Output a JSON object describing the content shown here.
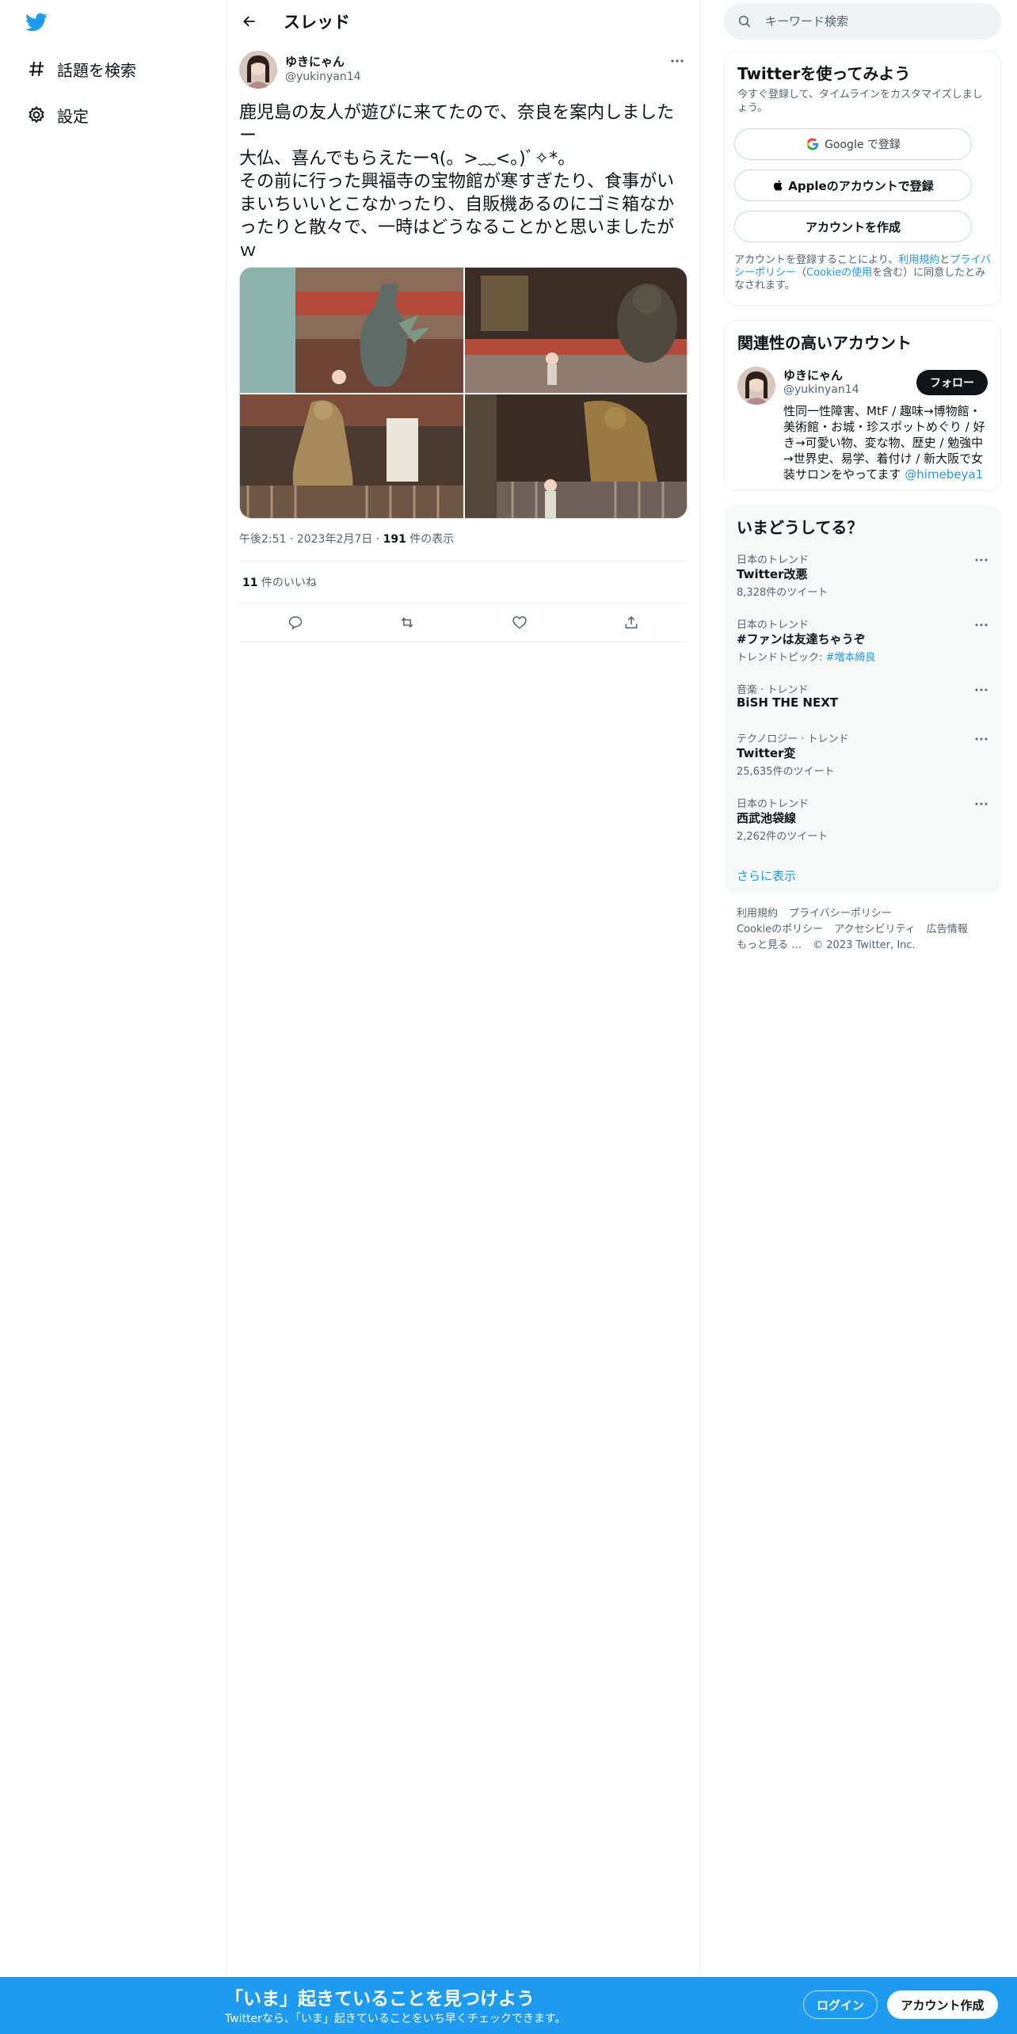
{
  "colors": {
    "accent": "#1d9bf0",
    "text": "#0f1419",
    "secondary": "#536471",
    "border": "#eff3f4"
  },
  "sidebar": {
    "logo_icon": "twitter-bird-icon",
    "items": [
      {
        "label": "話題を検索",
        "icon": "hashtag-icon"
      },
      {
        "label": "設定",
        "icon": "gear-icon"
      }
    ]
  },
  "header": {
    "back_icon": "arrow-left-icon",
    "title": "スレッド"
  },
  "tweet": {
    "author_name": "ゆきにゃん",
    "author_handle": "@yukinyan14",
    "text": "鹿児島の友人が遊びに来てたので、奈良を案内しましたー\n大仏、喜んでもらえたー٩(。>﹏<。)ﾞ✧*。\nその前に行った興福寺の宝物館が寒すぎたり、食事がいまいちいいとこなかったり、自販機あるのにゴミ箱なかったりと散々で、一時はどうなることかと思いましたがｗ",
    "timestamp": "午後2:51 · 2023年2月7日",
    "views_count": "191",
    "views_label": " 件の表示",
    "likes_count": "11",
    "likes_label": " 件のいいね"
  },
  "search": {
    "placeholder": "キーワード検索"
  },
  "signup_card": {
    "title": "Twitterを使ってみよう",
    "subtitle": "今すぐ登録して、タイムラインをカスタマイズしましょう。",
    "google_button": "Google で登録",
    "apple_button": "Appleのアカウントで登録",
    "create_button": "アカウントを作成",
    "legal_prefix": "アカウントを登録することにより、",
    "legal_terms": "利用規約",
    "legal_and": "と",
    "legal_privacy": "プライバシーポリシー",
    "legal_open": "（",
    "legal_cookie": "Cookieの使用",
    "legal_suffix": "を含む）に同意したとみなされます。"
  },
  "relevant": {
    "title": "関連性の高いアカウント",
    "name": "ゆきにゃん",
    "handle": "@yukinyan14",
    "follow_label": "フォロー",
    "bio": "性同一性障害、MtF / 趣味→博物館・美術館・お城・珍スポットめぐり / 好き→可愛い物、変な物、歴史 / 勉強中→世界史、易学、着付け / 新大阪で女装サロンをやってます ",
    "bio_link": "@himebeya1"
  },
  "trends": {
    "title": "いまどうしてる？",
    "items": [
      {
        "context": "日本のトレンド",
        "name": "Twitter改悪",
        "count": "8,328件のツイート"
      },
      {
        "context": "日本のトレンド",
        "name": "#ファンは友達ちゃうぞ",
        "count_prefix": "トレンドトピック: ",
        "count_tag": "#増本綺良"
      },
      {
        "context": "音楽 · トレンド",
        "name": "BiSH THE NEXT",
        "count": ""
      },
      {
        "context": "テクノロジー · トレンド",
        "name": "Twitter変",
        "count": "25,635件のツイート"
      },
      {
        "context": "日本のトレンド",
        "name": "西武池袋線",
        "count": "2,262件のツイート"
      }
    ],
    "show_more": "さらに表示"
  },
  "footer": {
    "links": [
      "利用規約",
      "プライバシーポリシー",
      "Cookieのポリシー",
      "アクセシビリティ",
      "広告情報",
      "もっと見る …"
    ],
    "copyright": "© 2023 Twitter, Inc."
  },
  "bottom_bar": {
    "title": "「いま」起きていることを見つけよう",
    "subtitle": "Twitterなら、「いま」起きていることをいち早くチェックできます。",
    "login": "ログイン",
    "signup": "アカウント作成"
  }
}
